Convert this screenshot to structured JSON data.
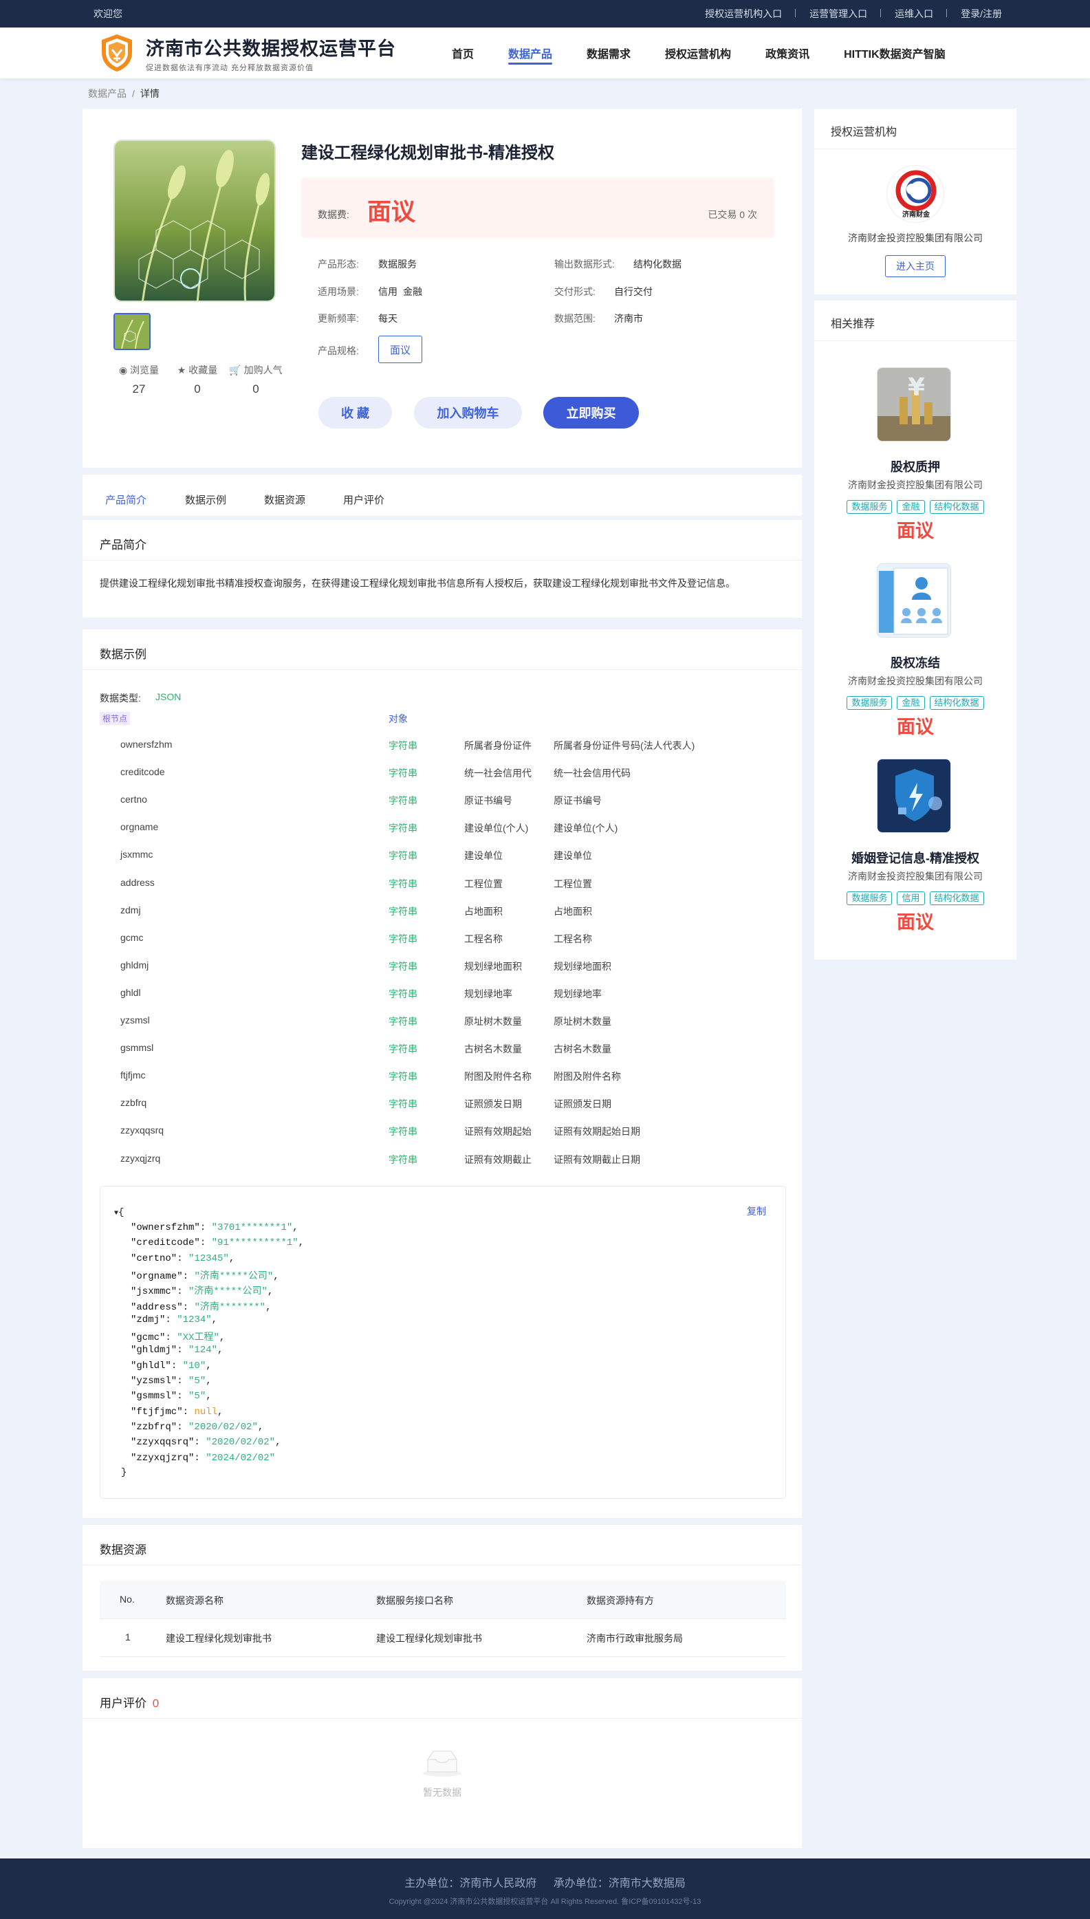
{
  "topbar": {
    "welcome": "欢迎您",
    "links": [
      "授权运营机构入口",
      "运营管理入口",
      "运维入口",
      "登录/注册"
    ]
  },
  "header": {
    "title": "济南市公共数据授权运营平台",
    "subtitle": "促进数据依法有序流动 充分释放数据资源价值",
    "nav": [
      "首页",
      "数据产品",
      "数据需求",
      "授权运营机构",
      "政策资讯",
      "HITTIK数据资产智脑"
    ],
    "active_nav": "数据产品"
  },
  "breadcrumb": {
    "parent": "数据产品",
    "separator": "/",
    "current": "详情"
  },
  "product": {
    "title": "建设工程绿化规划审批书-精准授权",
    "price_label": "数据费:",
    "price_value": "面议",
    "trade_text": "已交易 0 次",
    "attrs": {
      "form_label": "产品形态:",
      "form_value": "数据服务",
      "output_label": "输出数据形式:",
      "output_value": "结构化数据",
      "scene_label": "适用场景:",
      "scene_values": [
        "信用",
        "金融"
      ],
      "delivery_label": "交付形式:",
      "delivery_value": "自行交付",
      "freq_label": "更新频率:",
      "freq_value": "每天",
      "range_label": "数据范围:",
      "range_value": "济南市",
      "spec_label": "产品规格:",
      "spec_value": "面议"
    },
    "stats": [
      {
        "label": "浏览量",
        "value": "27"
      },
      {
        "label": "收藏量",
        "value": "0"
      },
      {
        "label": "加购人气",
        "value": "0"
      }
    ],
    "buttons": {
      "favorite": "收 藏",
      "cart": "加入购物车",
      "buy": "立即购买"
    }
  },
  "tabs": [
    "产品简介",
    "数据示例",
    "数据资源",
    "用户评价"
  ],
  "intro": {
    "title": "产品简介",
    "text": "提供建设工程绿化规划审批书精准授权查询服务，在获得建设工程绿化规划审批书信息所有人授权后，获取建设工程绿化规划审批书文件及登记信息。"
  },
  "sample": {
    "title": "数据示例",
    "type_label": "数据类型:",
    "type_value": "JSON",
    "root_label": "根节点",
    "root_type": "对象",
    "rows": [
      {
        "name": "ownersfzhm",
        "type": "字符串",
        "desc": "所属者身份证件",
        "full": "所属者身份证件号码(法人代表人)"
      },
      {
        "name": "creditcode",
        "type": "字符串",
        "desc": "统一社会信用代",
        "full": "统一社会信用代码"
      },
      {
        "name": "certno",
        "type": "字符串",
        "desc": "原证书编号",
        "full": "原证书编号"
      },
      {
        "name": "orgname",
        "type": "字符串",
        "desc": "建设单位(个人)",
        "full": "建设单位(个人)"
      },
      {
        "name": "jsxmmc",
        "type": "字符串",
        "desc": "建设单位",
        "full": "建设单位"
      },
      {
        "name": "address",
        "type": "字符串",
        "desc": "工程位置",
        "full": "工程位置"
      },
      {
        "name": "zdmj",
        "type": "字符串",
        "desc": "占地面积",
        "full": "占地面积"
      },
      {
        "name": "gcmc",
        "type": "字符串",
        "desc": "工程名称",
        "full": "工程名称"
      },
      {
        "name": "ghldmj",
        "type": "字符串",
        "desc": "规划绿地面积",
        "full": "规划绿地面积"
      },
      {
        "name": "ghldl",
        "type": "字符串",
        "desc": "规划绿地率",
        "full": "规划绿地率"
      },
      {
        "name": "yzsmsl",
        "type": "字符串",
        "desc": "原址树木数量",
        "full": "原址树木数量"
      },
      {
        "name": "gsmmsl",
        "type": "字符串",
        "desc": "古树名木数量",
        "full": "古树名木数量"
      },
      {
        "name": "ftjfjmc",
        "type": "字符串",
        "desc": "附图及附件名称",
        "full": "附图及附件名称"
      },
      {
        "name": "zzbfrq",
        "type": "字符串",
        "desc": "证照颁发日期",
        "full": "证照颁发日期"
      },
      {
        "name": "zzyxqqsrq",
        "type": "字符串",
        "desc": "证照有效期起始",
        "full": "证照有效期起始日期"
      },
      {
        "name": "zzyxqjzrq",
        "type": "字符串",
        "desc": "证照有效期截止",
        "full": "证照有效期截止日期"
      }
    ],
    "copy_label": "复制",
    "json_open": "{",
    "json_close": "}",
    "json_lines": [
      {
        "key": "\"ownersfzhm\"",
        "val": "\"3701*******1\"",
        "kind": "s"
      },
      {
        "key": "\"creditcode\"",
        "val": "\"91**********1\"",
        "kind": "s"
      },
      {
        "key": "\"certno\"",
        "val": "\"12345\"",
        "kind": "s"
      },
      {
        "key": "\"orgname\"",
        "val": "\"济南*****公司\"",
        "kind": "s"
      },
      {
        "key": "\"jsxmmc\"",
        "val": "\"济南*****公司\"",
        "kind": "s"
      },
      {
        "key": "\"address\"",
        "val": "\"济南*******\"",
        "kind": "s"
      },
      {
        "key": "\"zdmj\"",
        "val": "\"1234\"",
        "kind": "s"
      },
      {
        "key": "\"gcmc\"",
        "val": "\"XX工程\"",
        "kind": "s"
      },
      {
        "key": "\"ghldmj\"",
        "val": "\"124\"",
        "kind": "s"
      },
      {
        "key": "\"ghldl\"",
        "val": "\"10\"",
        "kind": "s"
      },
      {
        "key": "\"yzsmsl\"",
        "val": "\"5\"",
        "kind": "s"
      },
      {
        "key": "\"gsmmsl\"",
        "val": "\"5\"",
        "kind": "s"
      },
      {
        "key": "\"ftjfjmc\"",
        "val": "null",
        "kind": "n"
      },
      {
        "key": "\"zzbfrq\"",
        "val": "\"2020/02/02\"",
        "kind": "s"
      },
      {
        "key": "\"zzyxqqsrq\"",
        "val": "\"2020/02/02\"",
        "kind": "s"
      },
      {
        "key": "\"zzyxqjzrq\"",
        "val": "\"2024/02/02\"",
        "kind": "s"
      }
    ]
  },
  "resources": {
    "title": "数据资源",
    "headers": [
      "No.",
      "数据资源名称",
      "数据服务接口名称",
      "数据资源持有方"
    ],
    "rows": [
      [
        "1",
        "建设工程绿化规划审批书",
        "建设工程绿化规划审批书",
        "济南市行政审批服务局"
      ]
    ]
  },
  "reviews": {
    "title": "用户评价",
    "count": "0",
    "empty_text": "暂无数据"
  },
  "sidebar": {
    "org_title": "授权运营机构",
    "org_logo_text": "济南财金",
    "org_name": "济南财金投资控股集团有限公司",
    "org_button": "进入主页",
    "rec_title": "相关推荐",
    "recommendations": [
      {
        "title": "股权质押",
        "org": "济南财金投资控股集团有限公司",
        "tags": [
          "数据服务",
          "金融",
          "结构化数据"
        ],
        "price": "面议"
      },
      {
        "title": "股权冻结",
        "org": "济南财金投资控股集团有限公司",
        "tags": [
          "数据服务",
          "金融",
          "结构化数据"
        ],
        "price": "面议"
      },
      {
        "title": "婚姻登记信息-精准授权",
        "org": "济南财金投资控股集团有限公司",
        "tags": [
          "数据服务",
          "信用",
          "结构化数据"
        ],
        "price": "面议"
      }
    ]
  },
  "footer": {
    "host": "主办单位：济南市人民政府",
    "organizer": "承办单位：济南市大数据局",
    "copyright": "Copyright @2024 济南市公共数据授权运营平台 All Rights Reserved. 鲁ICP备09101432号-13"
  },
  "colors": {
    "primary": "#3d63dd",
    "price": "#f04a41",
    "dark": "#1d2c48",
    "green": "#29b46e"
  }
}
